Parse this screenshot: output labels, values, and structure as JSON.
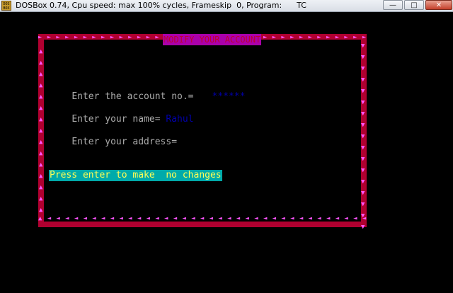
{
  "window": {
    "title": "DOSBox 0.74, Cpu speed: max 100% cycles, Frameskip  0, Program:      TC",
    "icon_text": "DOS BOX",
    "minimize_glyph": "—",
    "maximize_glyph": "□",
    "close_glyph": "✕"
  },
  "dialog": {
    "title": "MODIFY YOUR ACCOUNT",
    "border_top_arrows": "►►►►►►►►►►►►►►►►►►►►►►►►►►►►►►►►►►►►►►►",
    "border_bottom_arrows": "▲◄◄◄◄◄◄◄◄◄◄◄◄◄◄◄◄◄◄◄◄◄◄◄◄◄◄◄◄◄◄◄◄◄◄◄◄◄◄◄◄◄▼",
    "border_left_arrows": "▲▲▲▲▲▲▲▲▲▲▲▲▲▲▲",
    "border_right_arrows": "▼▼▼▼▼▼▼▼▼▼▼▼▼▼▼▼▼",
    "account_label": "Enter the account no.=",
    "account_value": "******",
    "name_label": "Enter your name=",
    "name_value": "Rahul",
    "address_label": "Enter your address=",
    "address_value": "",
    "hint": "Press enter to make  no changes"
  },
  "colors": {
    "border": "#b00030",
    "arrows": "#ff55ff",
    "title_bg": "#aa00aa",
    "label": "#aaaaaa",
    "value": "#0000aa",
    "hint_bg": "#00aaaa",
    "hint_fg": "#ffff55"
  }
}
